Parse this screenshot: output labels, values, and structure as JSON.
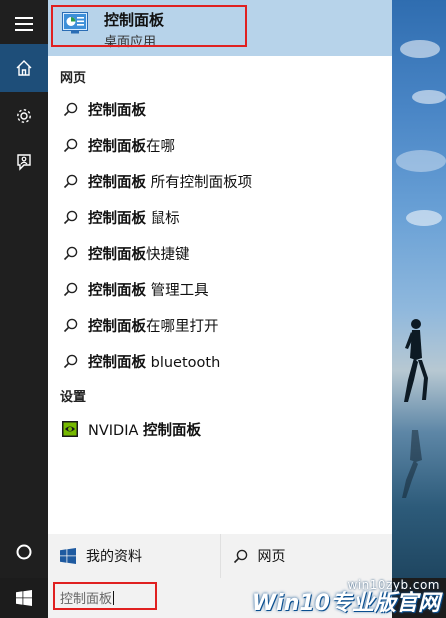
{
  "top_result": {
    "title": "控制面板",
    "subtitle": "桌面应用"
  },
  "sections": {
    "web": "网页",
    "settings": "设置"
  },
  "web_results": [
    {
      "bold": "控制面板",
      "rest": ""
    },
    {
      "bold": "控制面板",
      "rest": "在哪"
    },
    {
      "bold": "控制面板",
      "rest": " 所有控制面板项"
    },
    {
      "bold": "控制面板",
      "rest": " 鼠标"
    },
    {
      "bold": "控制面板",
      "rest": "快捷键"
    },
    {
      "bold": "控制面板",
      "rest": " 管理工具"
    },
    {
      "bold": "控制面板",
      "rest": "在哪里打开"
    },
    {
      "bold": "控制面板",
      "rest": " bluetooth"
    }
  ],
  "settings_results": [
    {
      "prefix": "NVIDIA ",
      "bold": "控制面板"
    }
  ],
  "bottom": {
    "my_stuff": "我的资料",
    "web": "网页"
  },
  "search": {
    "value": "控制面板"
  },
  "watermark": {
    "small": "win10zyb.com",
    "big": "Win10专业版官网"
  },
  "colors": {
    "accent_blue": "#1e4e79",
    "highlight": "#b7d3ea",
    "annotation_red": "#e02020"
  }
}
